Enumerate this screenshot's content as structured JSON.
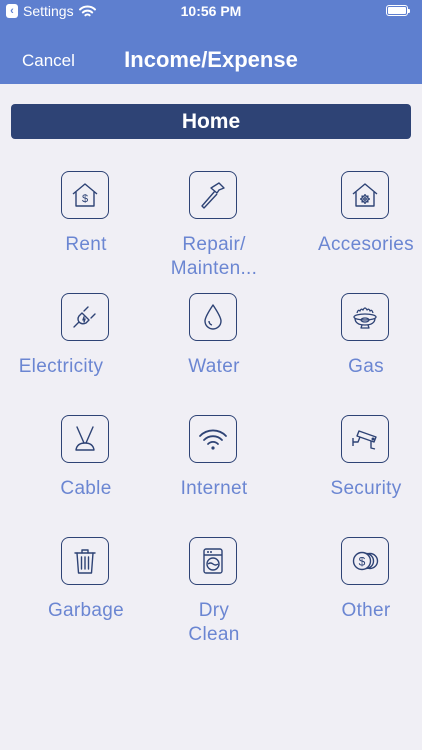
{
  "status_bar": {
    "carrier": "Settings",
    "time": "10:56 PM"
  },
  "nav": {
    "cancel_label": "Cancel",
    "title": "Income/Expense"
  },
  "section": {
    "title": "Home"
  },
  "colors": {
    "header_blue": "#5e7fcf",
    "navy": "#2e4375",
    "label_blue": "#6b86d2",
    "background": "#f0eff5"
  },
  "categories": [
    {
      "label": "Rent",
      "icon": "house-dollar-icon"
    },
    {
      "label": "Repair/\nMainten...",
      "icon": "hammer-icon"
    },
    {
      "label": "Accesories",
      "icon": "house-gear-icon"
    },
    {
      "label": "Electricity",
      "icon": "plug-icon"
    },
    {
      "label": "Water",
      "icon": "water-drop-icon"
    },
    {
      "label": "Gas",
      "icon": "gas-burner-icon"
    },
    {
      "label": "Cable",
      "icon": "tv-antenna-icon"
    },
    {
      "label": "Internet",
      "icon": "wifi-icon"
    },
    {
      "label": "Security",
      "icon": "security-camera-icon"
    },
    {
      "label": "Garbage",
      "icon": "trash-can-icon"
    },
    {
      "label": "Dry\nClean",
      "icon": "washing-machine-icon"
    },
    {
      "label": "Other",
      "icon": "coins-icon"
    }
  ]
}
